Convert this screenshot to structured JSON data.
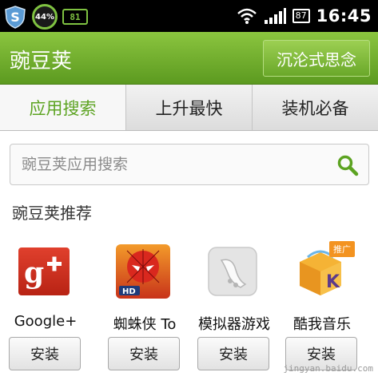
{
  "status_bar": {
    "shield_letter": "S",
    "battery_ring": "44%",
    "memory_badge": "81",
    "battery_level": "87",
    "time": "16:45"
  },
  "header": {
    "title": "豌豆荚",
    "action_label": "沉沦式思念"
  },
  "tabs": [
    {
      "label": "应用搜索",
      "active": true
    },
    {
      "label": "上升最快",
      "active": false
    },
    {
      "label": "装机必备",
      "active": false
    }
  ],
  "search": {
    "placeholder": "豌豆荚应用搜索",
    "icon": "search-icon"
  },
  "section": {
    "title": "豌豆荚推荐"
  },
  "apps": [
    {
      "name": "Google+",
      "install_label": "安装",
      "icon": "google-plus-icon"
    },
    {
      "name": "蜘蛛侠 To",
      "install_label": "安装",
      "icon": "spiderman-icon"
    },
    {
      "name": "模拟器游戏",
      "install_label": "安装",
      "icon": "emulator-icon"
    },
    {
      "name": "酷我音乐",
      "install_label": "安装",
      "icon": "kuwo-music-icon",
      "badge": "推广"
    }
  ],
  "watermark": "jingyan.baidu.com",
  "colors": {
    "brand_green": "#6aab2a",
    "active_tab_text": "#5ca321"
  }
}
